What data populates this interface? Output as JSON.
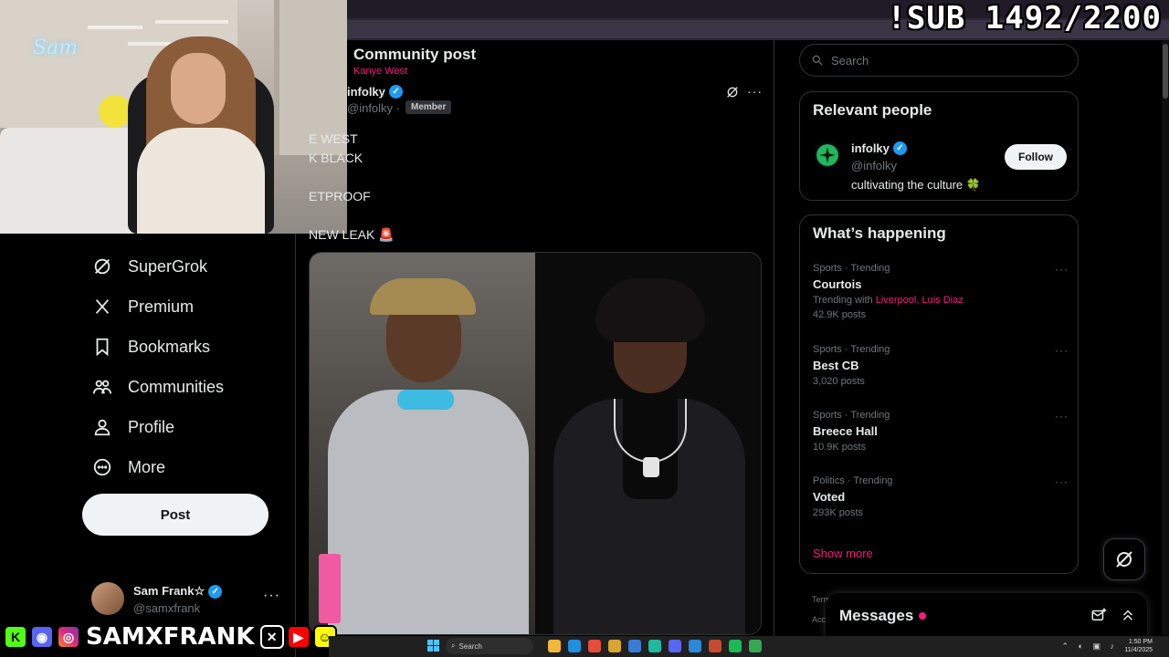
{
  "overlay": {
    "sub_counter": "!SUB 1492/2200",
    "neon_sign": "Sam",
    "streamer_handle": "SAMXFRANK"
  },
  "nav": {
    "items": [
      {
        "label": "SuperGrok",
        "icon": "grok-icon"
      },
      {
        "label": "Premium",
        "icon": "x-logo-icon"
      },
      {
        "label": "Bookmarks",
        "icon": "bookmark-icon"
      },
      {
        "label": "Communities",
        "icon": "people-icon"
      },
      {
        "label": "Profile",
        "icon": "person-icon"
      },
      {
        "label": "More",
        "icon": "more-circle-icon"
      }
    ],
    "post_label": "Post",
    "account": {
      "name": "Sam Frank☆",
      "handle": "@samxfrank",
      "more": "···"
    }
  },
  "main": {
    "title": "Community post",
    "subtitle": "Kanye West",
    "author": {
      "name": "infolky",
      "handle": "@infolky ·",
      "role": "Member"
    },
    "post_more": "···",
    "post_text": "E WEST\nK BLACK\n\nETPROOF\n\nNEW LEAK 🚨"
  },
  "right": {
    "search_placeholder": "Search",
    "relevant": {
      "title": "Relevant people",
      "person": {
        "name": "infolky",
        "handle": "@infolky",
        "bio": "cultivating the culture 🍀",
        "follow_label": "Follow"
      }
    },
    "happening": {
      "title": "What’s happening",
      "trends": [
        {
          "meta": "Sports · Trending",
          "topic": "Courtois",
          "with_prefix": "Trending with",
          "with_a": "Liverpool",
          "with_b": "Luis Diaz",
          "count": "42.9K posts"
        },
        {
          "meta": "Sports · Trending",
          "topic": "Best CB",
          "count": "3,020 posts"
        },
        {
          "meta": "Sports · Trending",
          "topic": "Breece Hall",
          "count": "10.9K posts"
        },
        {
          "meta": "Politics · Trending",
          "topic": "Voted",
          "count": "293K posts"
        }
      ],
      "dots": "···",
      "show_more": "Show more"
    },
    "footer": {
      "line1": "Term",
      "line2": "Acc"
    },
    "messages": {
      "title": "Messages"
    }
  },
  "taskbar": {
    "search_label": "Search",
    "time": "1:50 PM",
    "date": "11/4/2025"
  },
  "colors": {
    "accent": "#f91880",
    "verified": "#1d9bf0",
    "background": "#000000",
    "border": "#2f3336"
  }
}
